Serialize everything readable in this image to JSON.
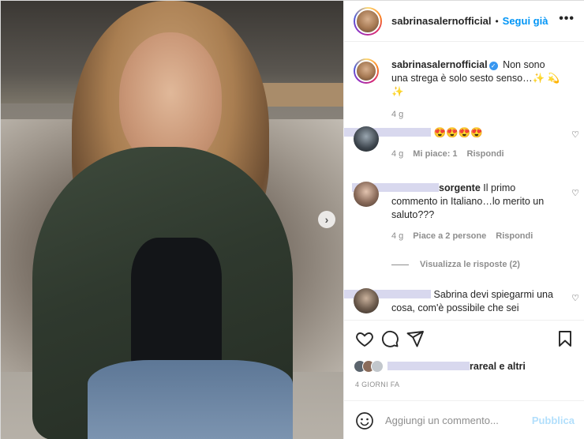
{
  "post": {
    "username": "sabrinasalernofficial",
    "follow_label": "Segui già",
    "more_label": "•••",
    "next_label": "›"
  },
  "caption": {
    "username": "sabrinasalernofficial",
    "text": "Non sono una strega è solo sesto senso…✨ 💫 ✨",
    "age": "4 g"
  },
  "comments": [
    {
      "username_visible": "",
      "text": "😍😍😍😍",
      "age": "4 g",
      "likes_label": "Mi piace: 1",
      "reply_label": "Rispondi"
    },
    {
      "username_visible": "sorgente",
      "text": "Il primo commento in Italiano…lo merito un saluto???",
      "age": "4 g",
      "likes_label": "Piace a 2 persone",
      "reply_label": "Rispondi",
      "view_replies_label": "Visualizza le risposte (2)"
    },
    {
      "username_visible": "",
      "text": "Sabrina devi spiegarmi una cosa, com'è possibile che sei"
    }
  ],
  "likes_bar": {
    "name_visible": "rareal",
    "suffix": "e altri"
  },
  "date_label": "4 GIORNI FA",
  "composer": {
    "placeholder": "Aggiungi un commento...",
    "publish_label": "Pubblica"
  },
  "colors": {
    "accent": "#0095f6",
    "publish_disabled": "#b2dffc",
    "muted": "#8e8e8e",
    "redaction": "#d8d8ee"
  },
  "icons": [
    "heart-icon",
    "comment-icon",
    "share-icon",
    "bookmark-icon",
    "emoji-icon",
    "chevron-right-icon",
    "more-icon",
    "verified-icon"
  ]
}
